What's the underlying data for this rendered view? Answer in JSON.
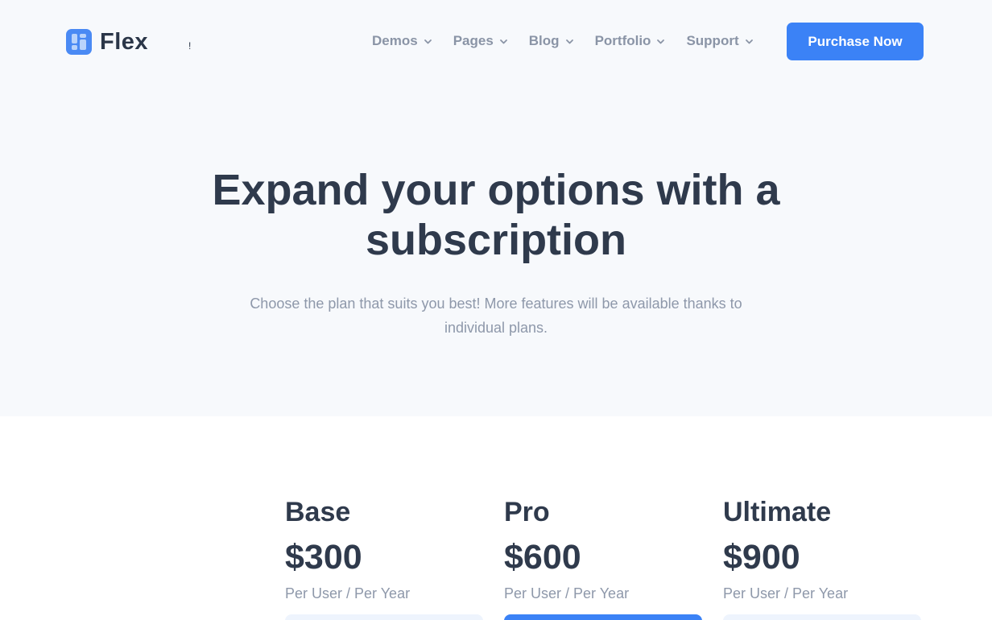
{
  "brand": {
    "name": "Flex",
    "stray_glyph": "!"
  },
  "nav": {
    "items": [
      {
        "label": "Demos"
      },
      {
        "label": "Pages"
      },
      {
        "label": "Blog"
      },
      {
        "label": "Portfolio"
      },
      {
        "label": "Support"
      }
    ],
    "cta_label": "Purchase Now"
  },
  "hero": {
    "title": "Expand your options with a subscription",
    "subtitle": "Choose the plan that suits you best! More features will be available thanks to individual plans."
  },
  "plans": [
    {
      "name": "Base",
      "price": "$300",
      "period": "Per User / Per Year"
    },
    {
      "name": "Pro",
      "price": "$600",
      "period": "Per User / Per Year"
    },
    {
      "name": "Ultimate",
      "price": "$900",
      "period": "Per User / Per Year"
    }
  ],
  "colors": {
    "accent": "#3b82f6",
    "hero_background": "#f7f9fc",
    "heading": "#2f3a4c",
    "muted_text": "#8e98aa"
  }
}
